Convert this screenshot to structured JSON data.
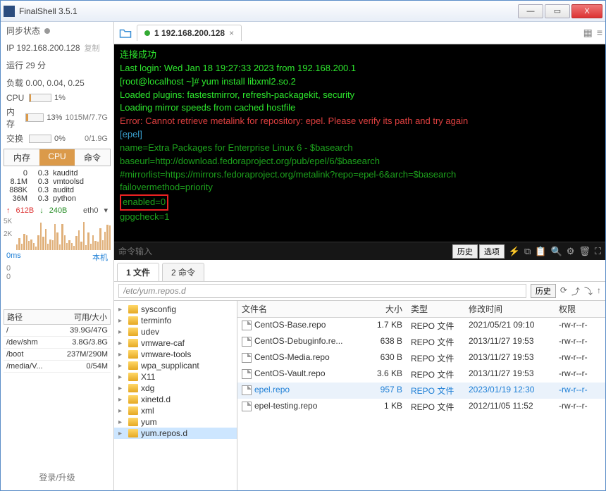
{
  "window": {
    "title": "FinalShell 3.5.1"
  },
  "sidebar": {
    "sync_label": "同步状态",
    "ip": "IP 192.168.200.128",
    "copy": "复制",
    "uptime": "运行 29 分",
    "load": "负载 0.00, 0.04, 0.25",
    "meters": {
      "cpu_label": "CPU",
      "cpu_pct": "1%",
      "mem_label": "内存",
      "mem_pct": "13%",
      "mem_right": "1015M/7.7G",
      "swap_label": "交换",
      "swap_pct": "0%",
      "swap_right": "0/1.9G"
    },
    "proc_tabs": {
      "mem": "内存",
      "cpu": "CPU",
      "cmd": "命令"
    },
    "procs": [
      {
        "mem": "0",
        "cpu": "0.3",
        "cmd": "kauditd"
      },
      {
        "mem": "8.1M",
        "cpu": "0.3",
        "cmd": "vmtoolsd"
      },
      {
        "mem": "888K",
        "cpu": "0.3",
        "cmd": "auditd"
      },
      {
        "mem": "36M",
        "cpu": "0.3",
        "cmd": "python"
      }
    ],
    "net": {
      "up": "612B",
      "down": "240B",
      "iface": "eth0"
    },
    "lat": {
      "ms": "0ms",
      "local": "本机",
      "v0": "0",
      "v1": "0"
    },
    "disk": {
      "hdr_path": "路径",
      "hdr_size": "可用/大小",
      "rows": [
        {
          "p": "/",
          "s": "39.9G/47G"
        },
        {
          "p": "/dev/shm",
          "s": "3.8G/3.8G"
        },
        {
          "p": "/boot",
          "s": "237M/290M"
        },
        {
          "p": "/media/V...",
          "s": "0/54M"
        }
      ]
    },
    "footer": "登录/升级"
  },
  "conn_tab": {
    "label": "1 192.168.200.128"
  },
  "terminal": {
    "l0": "连接成功",
    "l1": "Last login: Wed Jan 18 19:27:33 2023 from 192.168.200.1",
    "l2": "[root@localhost ~]# yum install libxml2.so.2",
    "l3": "Loaded plugins: fastestmirror, refresh-packagekit, security",
    "l4": "Loading mirror speeds from cached hostfile",
    "l5": "Error: Cannot retrieve metalink for repository: epel. Please verify its path and try again",
    "l6": "[epel]",
    "l7": "name=Extra Packages for Enterprise Linux 6 - $basearch",
    "l8": "baseurl=http://download.fedoraproject.org/pub/epel/6/$basearch",
    "l9": "#mirrorlist=https://mirrors.fedoraproject.org/metalink?repo=epel-6&arch=$basearch",
    "l10": "failovermethod=priority",
    "l11": "enabled=0",
    "l12": "gpgcheck=1",
    "input_placeholder": "命令输入",
    "history": "历史",
    "options": "选项"
  },
  "bottom_tabs": {
    "files": "1 文件",
    "cmds": "2 命令"
  },
  "path": {
    "value": "/etc/yum.repos.d",
    "history": "历史"
  },
  "tree": {
    "items": [
      "sysconfig",
      "terminfo",
      "udev",
      "vmware-caf",
      "vmware-tools",
      "wpa_supplicant",
      "X11",
      "xdg",
      "xinetd.d",
      "xml",
      "yum",
      "yum.repos.d"
    ]
  },
  "files": {
    "columns": {
      "name": "文件名",
      "size": "大小",
      "type": "类型",
      "date": "修改时间",
      "perm": "权限"
    },
    "rows": [
      {
        "name": "CentOS-Base.repo",
        "size": "1.7 KB",
        "type": "REPO 文件",
        "date": "2021/05/21 09:10",
        "perm": "-rw-r--r-"
      },
      {
        "name": "CentOS-Debuginfo.re...",
        "size": "638 B",
        "type": "REPO 文件",
        "date": "2013/11/27 19:53",
        "perm": "-rw-r--r-"
      },
      {
        "name": "CentOS-Media.repo",
        "size": "630 B",
        "type": "REPO 文件",
        "date": "2013/11/27 19:53",
        "perm": "-rw-r--r-"
      },
      {
        "name": "CentOS-Vault.repo",
        "size": "3.6 KB",
        "type": "REPO 文件",
        "date": "2013/11/27 19:53",
        "perm": "-rw-r--r-"
      },
      {
        "name": "epel.repo",
        "size": "957 B",
        "type": "REPO 文件",
        "date": "2023/01/19 12:30",
        "perm": "-rw-r--r-",
        "selected": true
      },
      {
        "name": "epel-testing.repo",
        "size": "1 KB",
        "type": "REPO 文件",
        "date": "2012/11/05 11:52",
        "perm": "-rw-r--r-"
      }
    ]
  }
}
